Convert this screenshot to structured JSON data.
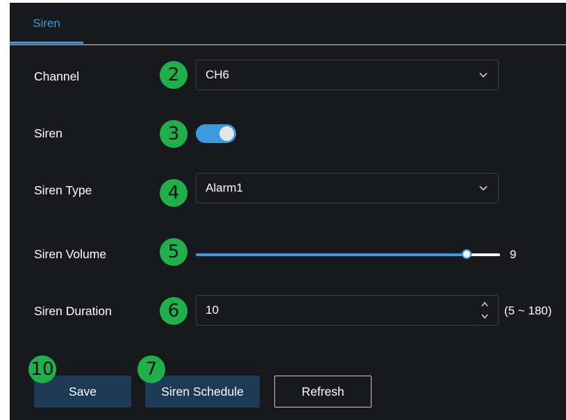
{
  "tabs": [
    {
      "label": "Siren",
      "active": true
    }
  ],
  "colors": {
    "accent": "#3a9be0",
    "panel_background": "#18191d",
    "badge_green": "#1fb04c",
    "button_fill": "#1e3a54"
  },
  "fields": {
    "channel": {
      "label": "Channel",
      "value": "CH6",
      "badge": "2"
    },
    "siren": {
      "label": "Siren",
      "enabled": true,
      "badge": "3"
    },
    "siren_type": {
      "label": "Siren Type",
      "value": "Alarm1",
      "badge": "4"
    },
    "siren_volume": {
      "label": "Siren Volume",
      "value": "9",
      "fraction": 0.89,
      "badge": "5"
    },
    "siren_duration": {
      "label": "Siren Duration",
      "value": "10",
      "range_hint": "(5 ~ 180)",
      "badge": "6"
    }
  },
  "buttons": {
    "save": {
      "label": "Save",
      "badge": "10"
    },
    "siren_schedule": {
      "label": "Siren Schedule",
      "badge": "7"
    },
    "refresh": {
      "label": "Refresh"
    }
  },
  "icons": {
    "dropdown": "chevron-down-icon",
    "stepper": "up-down-arrows-icon"
  }
}
